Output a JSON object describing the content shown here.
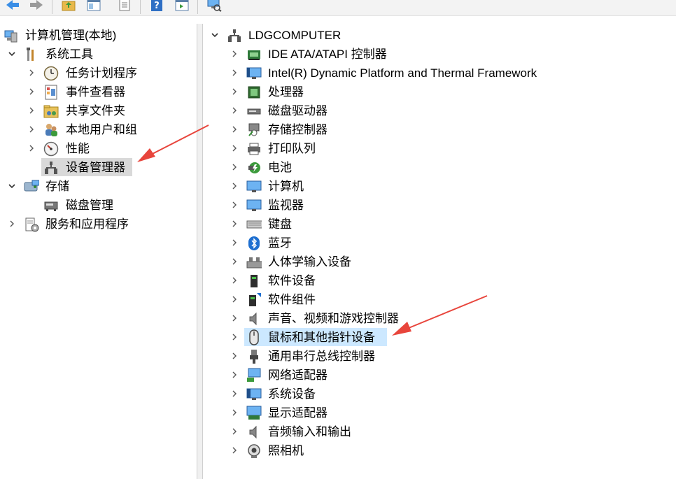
{
  "left_tree": {
    "root": "计算机管理(本地)",
    "system_tools": "系统工具",
    "task_scheduler": "任务计划程序",
    "event_viewer": "事件查看器",
    "shared_folders": "共享文件夹",
    "local_users": "本地用户和组",
    "performance": "性能",
    "device_manager": "设备管理器",
    "storage": "存储",
    "disk_management": "磁盘管理",
    "services_apps": "服务和应用程序"
  },
  "right_tree": {
    "root": "LDGCOMPUTER",
    "items": [
      {
        "label": "IDE ATA/ATAPI 控制器",
        "icon": "ide-controller-icon"
      },
      {
        "label": "Intel(R) Dynamic Platform and Thermal Framework",
        "icon": "monitor-blue-icon"
      },
      {
        "label": "处理器",
        "icon": "processor-icon"
      },
      {
        "label": "磁盘驱动器",
        "icon": "disk-drive-icon"
      },
      {
        "label": "存储控制器",
        "icon": "storage-controller-icon"
      },
      {
        "label": "打印队列",
        "icon": "printer-icon"
      },
      {
        "label": "电池",
        "icon": "battery-icon"
      },
      {
        "label": "计算机",
        "icon": "computer-icon"
      },
      {
        "label": "监视器",
        "icon": "monitor-icon"
      },
      {
        "label": "键盘",
        "icon": "keyboard-icon"
      },
      {
        "label": "蓝牙",
        "icon": "bluetooth-icon"
      },
      {
        "label": "人体学输入设备",
        "icon": "hid-icon"
      },
      {
        "label": "软件设备",
        "icon": "software-device-icon"
      },
      {
        "label": "软件组件",
        "icon": "software-component-icon"
      },
      {
        "label": "声音、视频和游戏控制器",
        "icon": "speaker-icon"
      },
      {
        "label": "鼠标和其他指针设备",
        "icon": "mouse-icon"
      },
      {
        "label": "通用串行总线控制器",
        "icon": "usb-icon"
      },
      {
        "label": "网络适配器",
        "icon": "network-adapter-icon"
      },
      {
        "label": "系统设备",
        "icon": "system-device-icon"
      },
      {
        "label": "显示适配器",
        "icon": "display-adapter-icon"
      },
      {
        "label": "音频输入和输出",
        "icon": "audio-io-icon"
      },
      {
        "label": "照相机",
        "icon": "camera-icon"
      }
    ]
  },
  "colors": {
    "annotation_arrow": "#e8453c",
    "selection": "#d9d9d9",
    "hover_highlight": "#cce8ff"
  }
}
